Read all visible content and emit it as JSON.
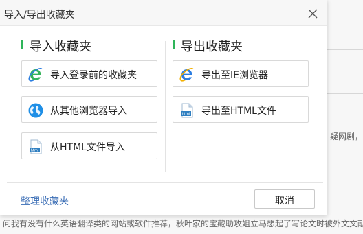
{
  "dialog": {
    "title": "导入/导出收藏夹",
    "close_icon": "close-icon",
    "import": {
      "title": "导入收藏夹",
      "buttons": [
        {
          "icon": "ie-logo-icon",
          "label": "导入登录前的收藏夹"
        },
        {
          "icon": "globe-icon",
          "label": "从其他浏览器导入"
        },
        {
          "icon": "html-file-icon",
          "label": "从HTML文件导入"
        }
      ]
    },
    "export": {
      "title": "导出收藏夹",
      "buttons": [
        {
          "icon": "ie-logo-icon",
          "label": "导出至IE浏览器"
        },
        {
          "icon": "html-file-icon",
          "label": "导出至HTML文件"
        }
      ]
    },
    "footer": {
      "organize_label": "整理收藏夹",
      "cancel_label": "取消"
    }
  },
  "background": {
    "right_snippet": "疑网剧，",
    "bottom_snippet": "问我有没有什么英语翻译类的网站或软件推荐，秋叶家的宝藏助攻姐立马想起了写论文时被外文文献"
  },
  "colors": {
    "accent_green": "#2fb55a",
    "link_blue": "#3a6db5",
    "ie_blue": "#2b7de1",
    "ie_green": "#35b35a",
    "globe_blue": "#1f8fe6",
    "html_blue": "#2f7fc1"
  }
}
